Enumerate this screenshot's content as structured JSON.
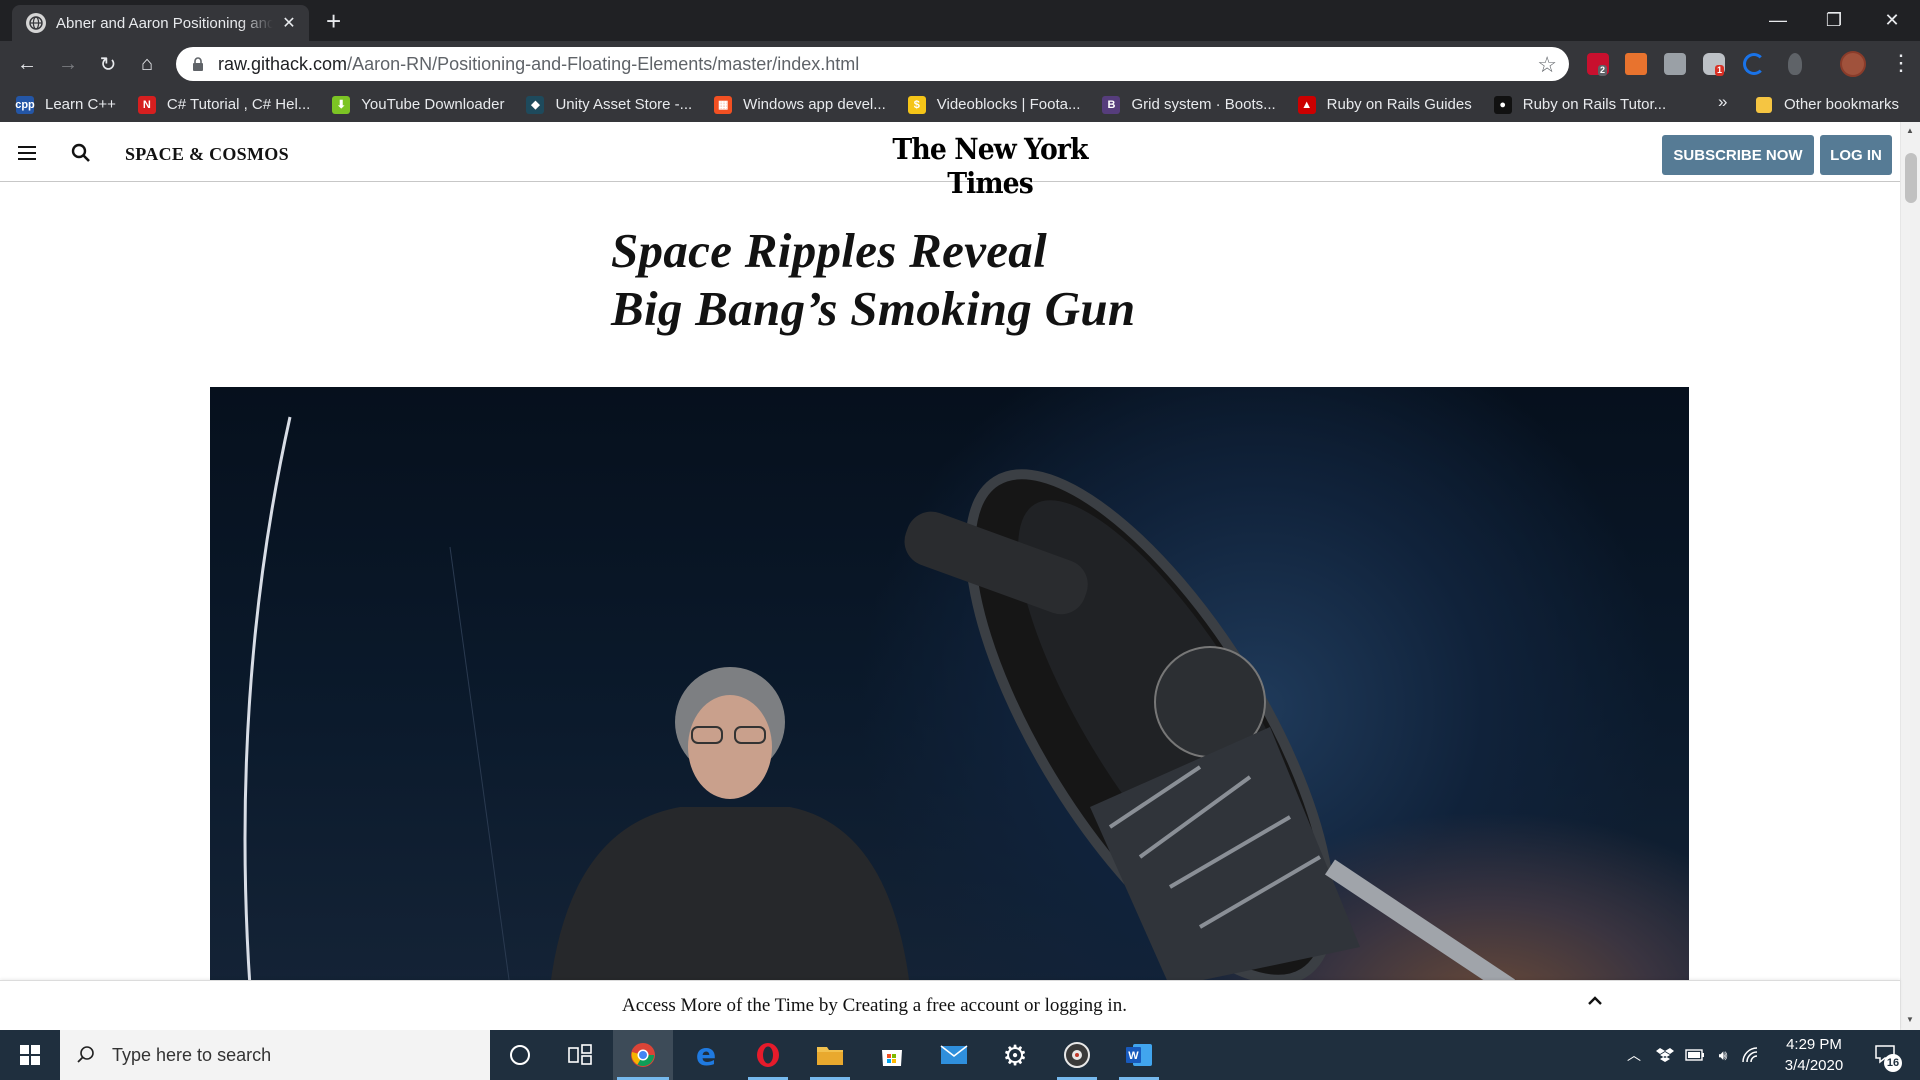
{
  "browser": {
    "tab_title": "Abner and Aaron Positioning and Floating Elements",
    "tab_close": "✕",
    "new_tab": "+",
    "url_host": "raw.githack.com",
    "url_path": "/Aaron-RN/Positioning-and-Floating-Elements/master/index.html",
    "window_controls": {
      "minimize": "—",
      "restore": "❐",
      "close": "✕"
    },
    "nav": {
      "back": "←",
      "forward": "→",
      "reload": "↻",
      "home": "⌂"
    },
    "star": "☆",
    "menu": "⋮",
    "extension_badges": {
      "abp": "2",
      "notif": "1"
    },
    "bookmarks": [
      {
        "label": "Learn C++",
        "icon": "cpp-icon",
        "color": "#2456a6",
        "glyph": "cpp"
      },
      {
        "label": "C# Tutorial , C# Hel...",
        "icon": "n-icon",
        "color": "#d61f1f",
        "glyph": "N"
      },
      {
        "label": "YouTube Downloader",
        "icon": "download-icon",
        "color": "#7cc424",
        "glyph": "⬇"
      },
      {
        "label": "Unity Asset Store -...",
        "icon": "unity-icon",
        "color": "#1e4a5c",
        "glyph": "◆"
      },
      {
        "label": "Windows app devel...",
        "icon": "windows-icon",
        "color": "#f25022",
        "glyph": "▦"
      },
      {
        "label": "Videoblocks | Foota...",
        "icon": "videoblocks-icon",
        "color": "#f5c518",
        "glyph": "$"
      },
      {
        "label": "Grid system · Boots...",
        "icon": "bootstrap-icon",
        "color": "#563d7c",
        "glyph": "B"
      },
      {
        "label": "Ruby on Rails Guides",
        "icon": "rails-icon",
        "color": "#cc0000",
        "glyph": "▲"
      },
      {
        "label": "Ruby on Rails Tutor...",
        "icon": "rails-tutorial-icon",
        "color": "#111111",
        "glyph": "●"
      }
    ],
    "bookmarks_more": "»",
    "other_bookmarks": "Other bookmarks"
  },
  "page": {
    "section": "SPACE & COSMOS",
    "logo": "The New York Times",
    "subscribe": "SUBSCRIBE NOW",
    "login": "LOG IN",
    "headline_line1": "Space Ripples Reveal",
    "headline_line2": "Big Bang’s Smoking Gun",
    "hero_image": "photo of a scientist standing beside a large radio telescope at dusk",
    "access_text": "Access More of the Time by Creating a free account or logging in.",
    "colors": {
      "button": "#567b95",
      "text": "#121212"
    }
  },
  "taskbar": {
    "search_placeholder": "Type here to search",
    "time": "4:29 PM",
    "date": "3/4/2020",
    "notification_count": "16"
  }
}
